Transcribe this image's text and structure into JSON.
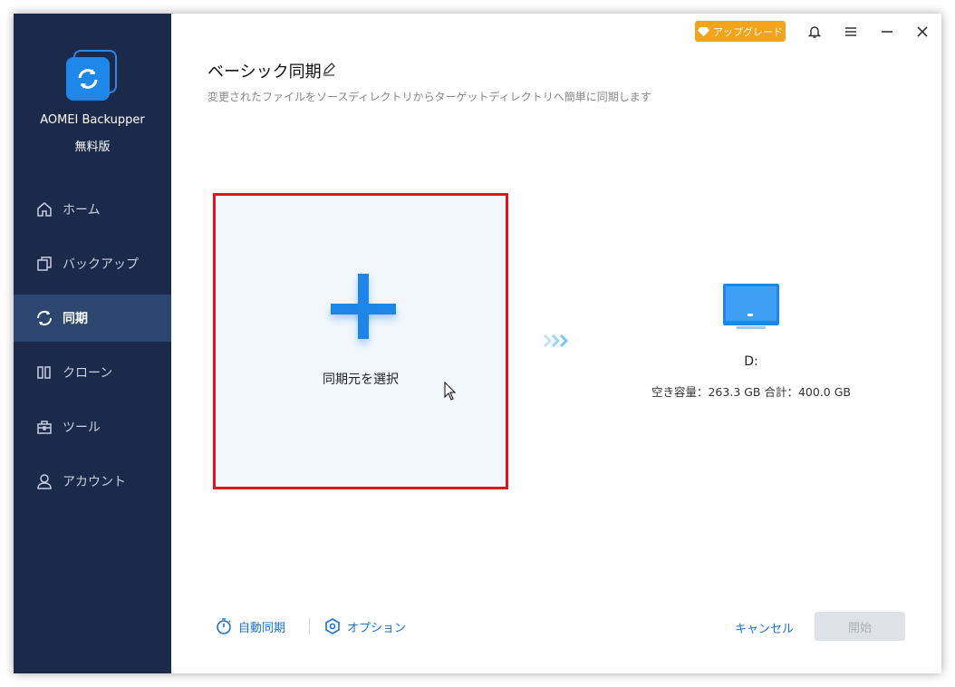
{
  "app": {
    "name": "AOMEI Backupper",
    "edition": "無料版"
  },
  "sidebar": {
    "items": [
      {
        "label": "ホーム",
        "icon": "home-icon"
      },
      {
        "label": "バックアップ",
        "icon": "backup-icon"
      },
      {
        "label": "同期",
        "icon": "sync-icon",
        "active": true
      },
      {
        "label": "クローン",
        "icon": "clone-icon"
      },
      {
        "label": "ツール",
        "icon": "toolbox-icon"
      },
      {
        "label": "アカウント",
        "icon": "user-icon"
      }
    ]
  },
  "header": {
    "upgrade_label": "アップグレード"
  },
  "page": {
    "title": "ベーシック同期",
    "subtitle": "変更されたファイルをソースディレクトリからターゲットディレクトリへ簡単に同期します"
  },
  "source": {
    "label": "同期元を選択"
  },
  "destination": {
    "name": "D:",
    "info": "空き容量：263.3 GB 合計：400.0 GB"
  },
  "footer": {
    "auto_sync_label": "自動同期",
    "options_label": "オプション",
    "cancel_label": "キャンセル",
    "start_label": "開始"
  },
  "colors": {
    "accent": "#1d86e8",
    "sidebar": "#1b2a4a",
    "highlight": "#e0151f",
    "upgrade": "#f5a31a"
  }
}
